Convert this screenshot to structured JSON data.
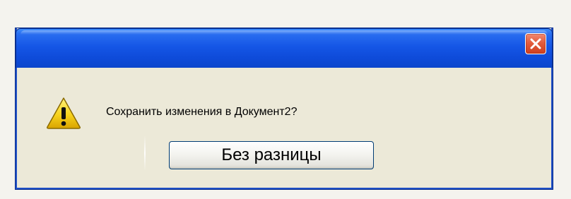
{
  "dialog": {
    "title": "",
    "message": "Сохранить изменения в Документ2?",
    "button_label": "Без разницы",
    "icons": {
      "close": "close-icon",
      "warning": "warning-icon"
    },
    "colors": {
      "titlebar": "#1556e6",
      "close_button": "#e35c3d",
      "background": "#ece9d8",
      "warning_fill": "#f7d21c"
    }
  }
}
